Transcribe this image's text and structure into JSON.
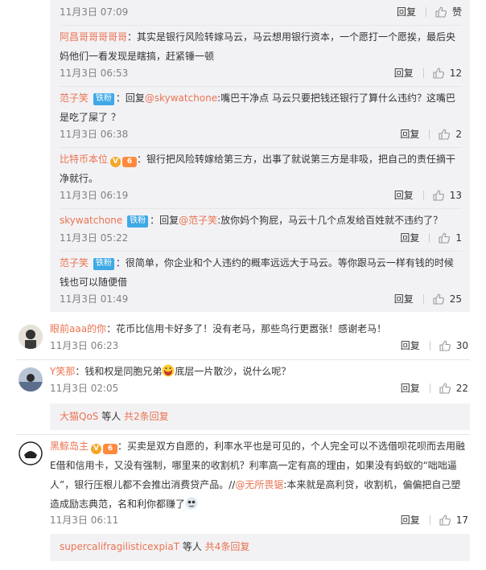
{
  "reply_label": "回复",
  "replies": [
    {
      "user": "",
      "badge": "",
      "text": "",
      "time": "11月3日 07:09",
      "likes": "赞"
    },
    {
      "user": "阿昌哥哥哥哥哥",
      "sep": "：",
      "text": "其实是银行风险转嫁马云，马云想用银行资本，一个愿打一个愿挨，最后央妈他们一看发现是瞎搞，赶紧锤一顿",
      "time": "11月3日 06:53",
      "likes": "12"
    },
    {
      "user": "范子笑",
      "badge": "铁粉",
      "sep": "：回复",
      "mention": "@skywatchone",
      "text": ":嘴巴干净点  马云只要把钱还银行了算什么违约？这嘴巴是吃了屎了 ？",
      "time": "11月3日 06:38",
      "likes": "2"
    },
    {
      "user": "比特币本位",
      "v": "V",
      "lvl": "6",
      "sep": "：",
      "text": "银行把风险转嫁给第三方，出事了就说第三方是非吸，把自己的责任摘干净就行。",
      "time": "11月3日 06:19",
      "likes": "13"
    },
    {
      "user": "skywatchone",
      "badge": "铁粉",
      "sep": "：回复",
      "mention": "@范子笑",
      "text": ":放你妈个狗屁，马云十几个点发给百姓就不违约了？",
      "time": "11月3日 05:22",
      "likes": "1"
    },
    {
      "user": "范子笑",
      "badge": "铁粉",
      "sep": "：",
      "text": "很简单，你企业和个人违约的概率远远大于马云。等你跟马云一样有钱的时候钱也可以随便借",
      "time": "11月3日 01:49",
      "likes": "25"
    }
  ],
  "comments": [
    {
      "user": "眼前aaa的你",
      "sep": "：",
      "text": "花币比信用卡好多了！没有老马，那些鸟行更嚣张！感谢老马！",
      "time": "11月3日 06:23",
      "likes": "30"
    },
    {
      "user": "Y笑那",
      "sep": "：",
      "text": "钱和权是同胞兄弟",
      "text2": "底层一片散沙，说什么呢？",
      "time": "11月3日 02:05",
      "likes": "22",
      "more_user": "大猫QoS",
      "more_mid": " 等人 ",
      "more_link": "共2条回复"
    },
    {
      "user": "黑鲸岛主",
      "v": "V",
      "lvl": "6",
      "sep": "：",
      "text": "买卖是双方自愿的，利率水平也是可见的，个人完全可以不选借呗花呗而去用融E借和信用卡，又没有强制，哪里来的收割机？利率高一定有高的理由，如果没有蚂蚁的“咄咄逼人”，银行压根儿都不会推出消费贷产品。//",
      "mention": "@无所畏锯",
      "text2": ":本来就是高利贷，收割机，偏偏把自己塑造成励志典范，名和利你都赚了",
      "time": "11月3日 06:11",
      "likes": "17",
      "more_user": "supercalifragilisticexpiaT",
      "more_mid": " 等人 ",
      "more_link": "共4条回复"
    }
  ],
  "colors": {
    "link": "#eb7350",
    "fan_badge": "#3fa9e6",
    "sub_panel": "#f2f2f5"
  },
  "icons": {
    "like": "thumbs-up-icon",
    "verified": "verified-v-icon",
    "level": "level-badge-icon",
    "emoji": "emoji-icon"
  }
}
